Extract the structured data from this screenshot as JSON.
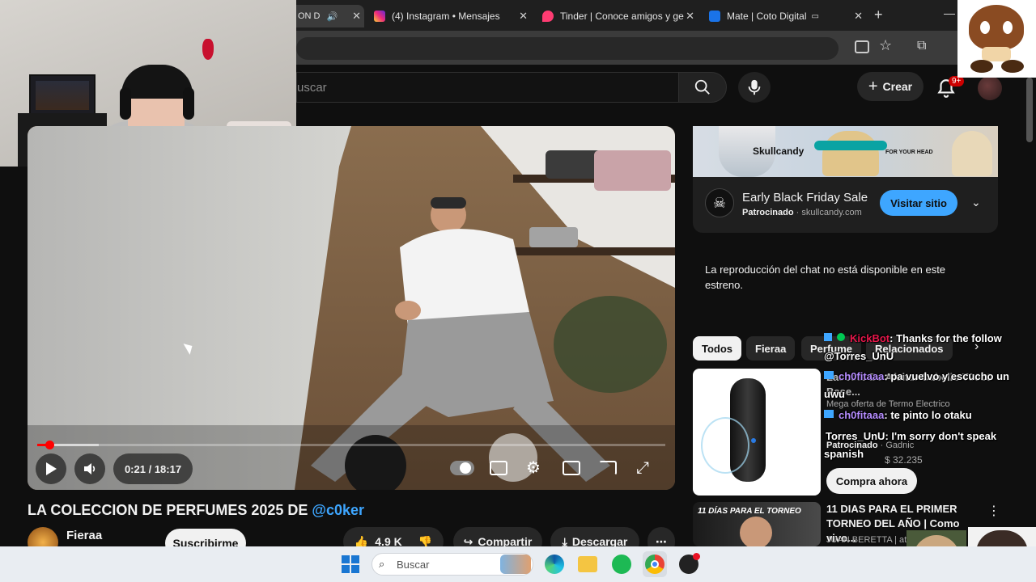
{
  "browser": {
    "tabs": [
      {
        "label": "ON D",
        "color": "#ff0000"
      },
      {
        "label": "(4) Instagram • Mensajes",
        "color": "#d6249f"
      },
      {
        "label": "Tinder | Conoce amigos y ge",
        "color": "#fe3c72"
      },
      {
        "label": "Mate | Coto Digital",
        "color": "#1a73e8"
      }
    ],
    "new_tab": "+",
    "window_min": "—"
  },
  "header": {
    "search_placeholder": "uscar",
    "create_label": "Crear",
    "notif_count": "9+"
  },
  "player": {
    "time_current": "0:21",
    "time_sep": " / ",
    "time_total": "18:17",
    "progress": 0.019,
    "buffered": 0.098
  },
  "video": {
    "title": "LA COLECCION DE PERFUMES 2025 DE ",
    "mention": "@c0ker",
    "channel": "Fieraa",
    "subscribe_label": "Suscribirme",
    "likes": "4.9 K",
    "share_label": "Compartir",
    "download_label": "Descargar"
  },
  "ad": {
    "brand_text": "Skullcandy",
    "banner_tag": "FOR YOUR HEAD",
    "title": "Early Black Friday Sale",
    "sponsored": "Patrocinado",
    "domain": "skullcandy.com",
    "cta": "Visitar sitio"
  },
  "chat": {
    "unavailable": "La reproducción del chat no está disponible en este estreno."
  },
  "chips": [
    "Todos",
    "Fieraa",
    "Perfume",
    "Relacionados"
  ],
  "rec_ad": {
    "title_line": "Mega oferta de Termo Electrico",
    "partial_title": "Lacoste Be Afeitar Cabello T9000 Base...",
    "sponsored": "Patrocinado",
    "advertiser": "Gadnic",
    "price": "$ 32.235",
    "cta": "Compra ahora"
  },
  "rec_video": {
    "thumb_text": "11 DÍAS PARA EL TORNEO",
    "title": "11 DIAS PARA EL PRIMER TORNEO DEL AÑO | Como vivo...",
    "channel": "JUAN BERETTA | atl"
  },
  "overlay_chat": [
    {
      "user": "KickBot",
      "text": ": Thanks for the follow",
      "cont": "@Torres_UnU",
      "color": "#e8174b"
    },
    {
      "user": "ch0fitaaa",
      "text": ": pa vuelvo y escucho un",
      "cont": "uwu",
      "color": "#b58cff"
    },
    {
      "user": "ch0fitaaa",
      "text": ": te pinto lo otaku",
      "cont": "",
      "color": "#b58cff"
    },
    {
      "user": "Torres_UnU",
      "text": ": I'm sorry don't speak",
      "cont": "spanish",
      "color": "#ffffff"
    }
  ],
  "taskbar": {
    "search_label": "Buscar"
  }
}
